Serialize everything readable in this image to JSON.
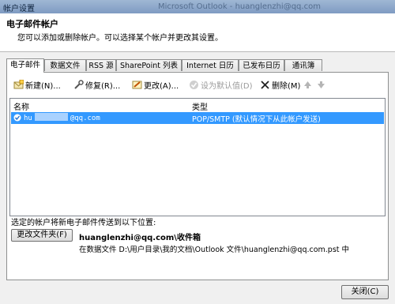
{
  "window": {
    "title": "帐户设置",
    "background_title": "Microsoft Outlook - huanglenzhi@qq.com"
  },
  "header": {
    "title": "电子邮件帐户",
    "subtitle": "您可以添加或删除帐户。可以选择某个帐户并更改其设置。"
  },
  "tabs": [
    {
      "label": "电子邮件",
      "active": true
    },
    {
      "label": "数据文件"
    },
    {
      "label": "RSS 源"
    },
    {
      "label": "SharePoint 列表"
    },
    {
      "label": "Internet 日历"
    },
    {
      "label": "已发布日历"
    },
    {
      "label": "通讯簿"
    }
  ],
  "toolbar": {
    "new_label": "新建(N)...",
    "repair_label": "修复(R)...",
    "change_label": "更改(A)...",
    "default_label": "设为默认值(D)",
    "remove_label": "删除(M)"
  },
  "list": {
    "col_name": "名称",
    "col_type": "类型",
    "rows": [
      {
        "name_prefix": "hu",
        "name_suffix": "@qq.com",
        "type": "POP/SMTP (默认情况下从此帐户发送)"
      }
    ]
  },
  "delivery": {
    "label": "选定的帐户将新电子邮件传送到以下位置:",
    "change_folder_label": "更改文件夹(F)",
    "inbox_path": "huanglenzhi@qq.com\\收件箱",
    "data_file_text": "在数据文件 D:\\用户目录\\我的文档\\Outlook 文件\\huanglenzhi@qq.com.pst 中"
  },
  "footer": {
    "close_label": "关闭(C)"
  },
  "colors": {
    "selection": "#3399ff",
    "titlebar": "#8aa6cb"
  }
}
